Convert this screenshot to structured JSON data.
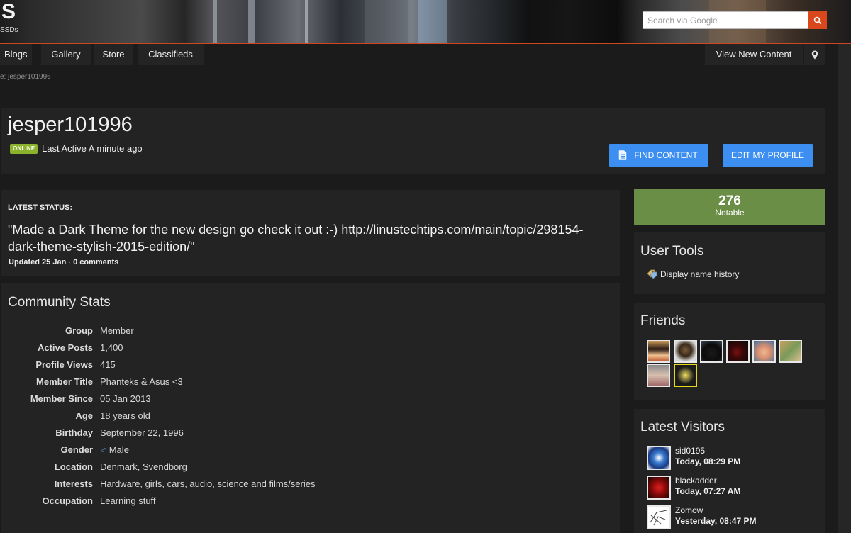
{
  "header": {
    "logo_text": "S",
    "logo_subtext": "SSDs",
    "search_placeholder": "Search via Google",
    "search_icon": "search-icon"
  },
  "nav": {
    "items": [
      "Blogs",
      "Gallery",
      "Store",
      "Classifieds"
    ],
    "view_new_content": "View New Content",
    "pin_icon": "map-pin-icon"
  },
  "breadcrumb": "e: jesper101996",
  "profile": {
    "username": "jesper101996",
    "online_badge": "ONLINE",
    "last_active": "Last Active A minute ago",
    "find_content_label": "FIND CONTENT",
    "edit_profile_label": "EDIT MY PROFILE"
  },
  "status": {
    "label": "LATEST STATUS:",
    "text": "\"Made a Dark Theme for the new design go check it out :-) http://linustechtips.com/main/topic/298154-dark-theme-stylish-2015-edition/\"",
    "updated": "Updated 25 Jan",
    "separator": " · ",
    "comments": "0 comments"
  },
  "stats": {
    "title": "Community Stats",
    "rows": [
      {
        "label": "Group",
        "value": "Member"
      },
      {
        "label": "Active Posts",
        "value": "1,400"
      },
      {
        "label": "Profile Views",
        "value": "415"
      },
      {
        "label": "Member Title",
        "value": "Phanteks & Asus <3"
      },
      {
        "label": "Member Since",
        "value": "05 Jan 2013"
      },
      {
        "label": "Age",
        "value": "18 years old"
      },
      {
        "label": "Birthday",
        "value": "September 22, 1996"
      },
      {
        "label": "Gender",
        "value": "Male"
      },
      {
        "label": "Location",
        "value": "Denmark, Svendborg"
      },
      {
        "label": "Interests",
        "value": "Hardware, girls, cars, audio, science and films/series"
      },
      {
        "label": "Occupation",
        "value": "Learning stuff"
      }
    ]
  },
  "reputation": {
    "value": "276",
    "label": "Notable",
    "color": "#6a8e46"
  },
  "user_tools": {
    "title": "User Tools",
    "display_name_history": "Display name history"
  },
  "friends": {
    "title": "Friends",
    "count_shown": 8
  },
  "visitors": {
    "title": "Latest Visitors",
    "items": [
      {
        "name": "sid0195",
        "time": "Today, 08:29 PM"
      },
      {
        "name": "blackadder",
        "time": "Today, 07:27 AM"
      },
      {
        "name": "Zomow",
        "time": "Yesterday, 08:47 PM"
      }
    ]
  },
  "colors": {
    "accent": "#d9481c",
    "button_blue": "#3c8ff0",
    "online_green": "#8bb22c",
    "background": "#1b1b1b",
    "panel": "#232323"
  }
}
